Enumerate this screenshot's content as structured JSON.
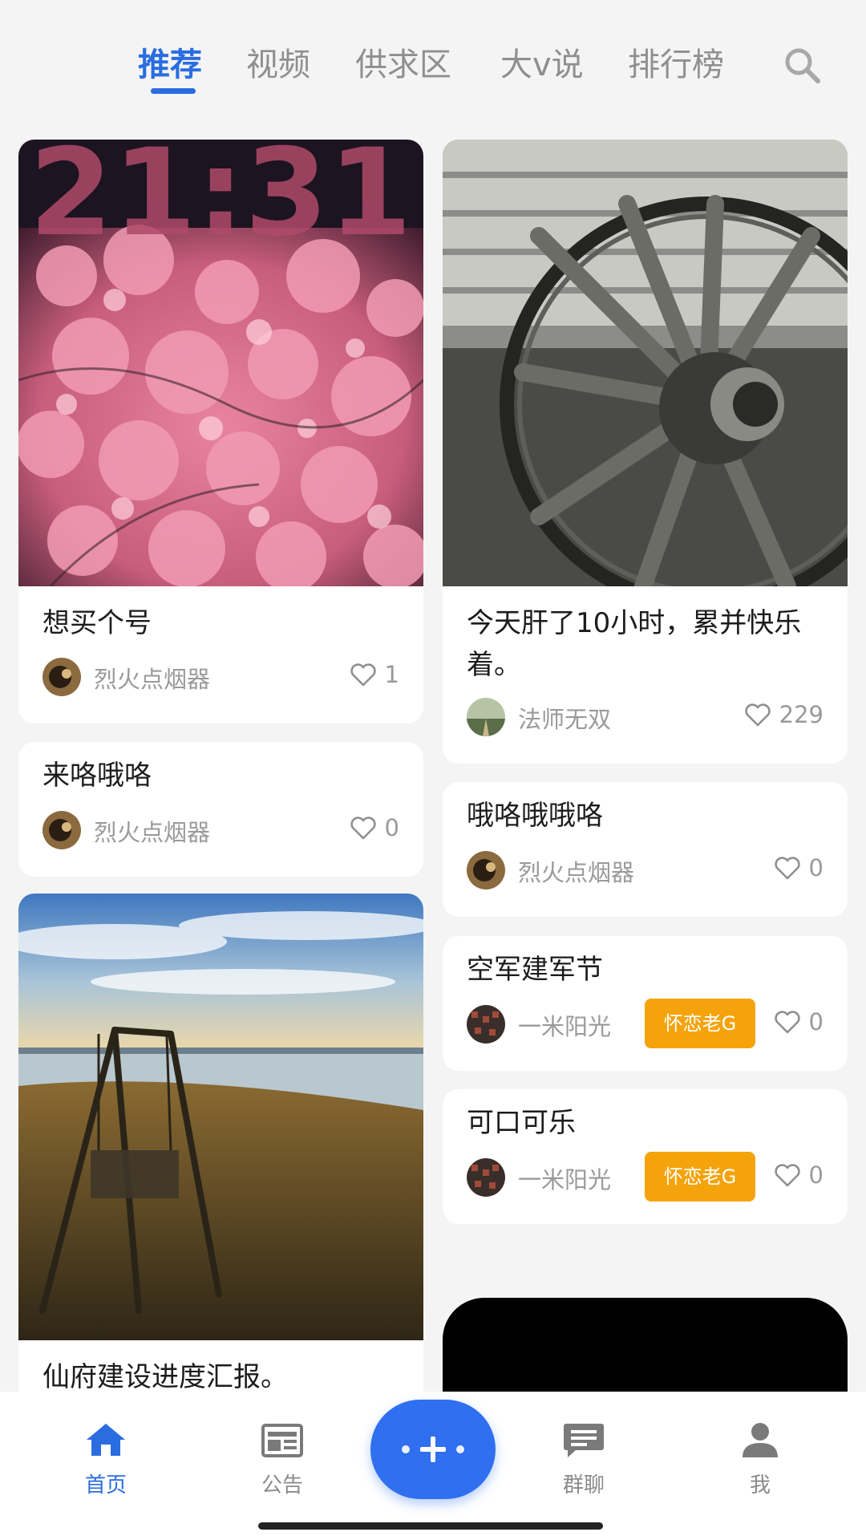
{
  "tabs": {
    "recommend": "推荐",
    "video": "视频",
    "supply": "供求区",
    "bigv": "大v说",
    "ranking": "排行榜"
  },
  "posts": {
    "p1": {
      "title": "想买个号",
      "author": "烈火点烟器",
      "likes": "1",
      "image_text": "21:31"
    },
    "p2": {
      "title": "今天肝了10小时，累并快乐着。",
      "author": "法师无双",
      "likes": "229"
    },
    "p3": {
      "title": "来咯哦咯",
      "author": "烈火点烟器",
      "likes": "0"
    },
    "p4": {
      "title": "哦咯哦哦咯",
      "author": "烈火点烟器",
      "likes": "0"
    },
    "p5": {
      "title": "空军建军节",
      "author": "一米阳光",
      "badge": "怀恋老G",
      "likes": "0"
    },
    "p6": {
      "title": "可口可乐",
      "author": "一米阳光",
      "badge": "怀恋老G",
      "likes": "0"
    },
    "p7": {
      "title": "仙府建设进度汇报。"
    }
  },
  "nav": {
    "home": "首页",
    "notice": "公告",
    "chat": "群聊",
    "me": "我"
  },
  "colors": {
    "accent": "#2a6de0",
    "badge": "#f5a30a",
    "fab": "#2f6ff0",
    "background": "#f4f4f4"
  },
  "icons": {
    "search": "search-icon",
    "like": "heart-outline-icon",
    "home": "home-icon",
    "notice": "newspaper-icon",
    "add": "plus-icon",
    "chat": "chat-bubble-icon",
    "me": "person-icon"
  }
}
